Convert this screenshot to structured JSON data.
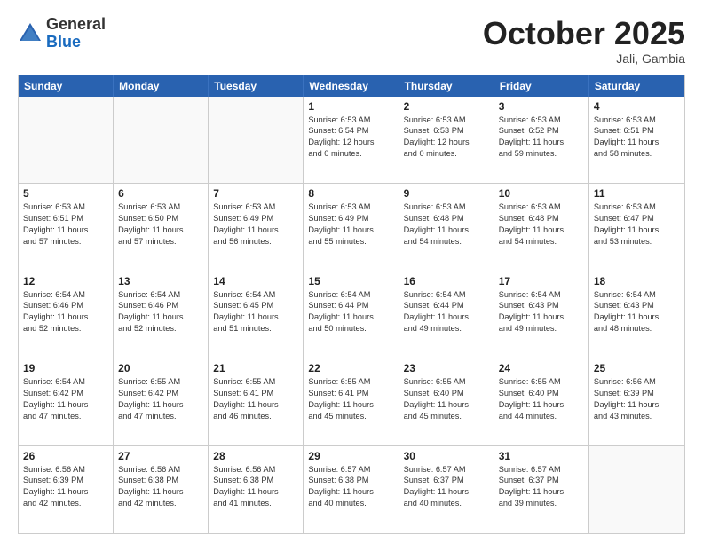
{
  "header": {
    "logo": {
      "general": "General",
      "blue": "Blue"
    },
    "title": "October 2025",
    "location": "Jali, Gambia"
  },
  "weekdays": [
    "Sunday",
    "Monday",
    "Tuesday",
    "Wednesday",
    "Thursday",
    "Friday",
    "Saturday"
  ],
  "rows": [
    [
      {
        "day": "",
        "text": ""
      },
      {
        "day": "",
        "text": ""
      },
      {
        "day": "",
        "text": ""
      },
      {
        "day": "1",
        "text": "Sunrise: 6:53 AM\nSunset: 6:54 PM\nDaylight: 12 hours\nand 0 minutes."
      },
      {
        "day": "2",
        "text": "Sunrise: 6:53 AM\nSunset: 6:53 PM\nDaylight: 12 hours\nand 0 minutes."
      },
      {
        "day": "3",
        "text": "Sunrise: 6:53 AM\nSunset: 6:52 PM\nDaylight: 11 hours\nand 59 minutes."
      },
      {
        "day": "4",
        "text": "Sunrise: 6:53 AM\nSunset: 6:51 PM\nDaylight: 11 hours\nand 58 minutes."
      }
    ],
    [
      {
        "day": "5",
        "text": "Sunrise: 6:53 AM\nSunset: 6:51 PM\nDaylight: 11 hours\nand 57 minutes."
      },
      {
        "day": "6",
        "text": "Sunrise: 6:53 AM\nSunset: 6:50 PM\nDaylight: 11 hours\nand 57 minutes."
      },
      {
        "day": "7",
        "text": "Sunrise: 6:53 AM\nSunset: 6:49 PM\nDaylight: 11 hours\nand 56 minutes."
      },
      {
        "day": "8",
        "text": "Sunrise: 6:53 AM\nSunset: 6:49 PM\nDaylight: 11 hours\nand 55 minutes."
      },
      {
        "day": "9",
        "text": "Sunrise: 6:53 AM\nSunset: 6:48 PM\nDaylight: 11 hours\nand 54 minutes."
      },
      {
        "day": "10",
        "text": "Sunrise: 6:53 AM\nSunset: 6:48 PM\nDaylight: 11 hours\nand 54 minutes."
      },
      {
        "day": "11",
        "text": "Sunrise: 6:53 AM\nSunset: 6:47 PM\nDaylight: 11 hours\nand 53 minutes."
      }
    ],
    [
      {
        "day": "12",
        "text": "Sunrise: 6:54 AM\nSunset: 6:46 PM\nDaylight: 11 hours\nand 52 minutes."
      },
      {
        "day": "13",
        "text": "Sunrise: 6:54 AM\nSunset: 6:46 PM\nDaylight: 11 hours\nand 52 minutes."
      },
      {
        "day": "14",
        "text": "Sunrise: 6:54 AM\nSunset: 6:45 PM\nDaylight: 11 hours\nand 51 minutes."
      },
      {
        "day": "15",
        "text": "Sunrise: 6:54 AM\nSunset: 6:44 PM\nDaylight: 11 hours\nand 50 minutes."
      },
      {
        "day": "16",
        "text": "Sunrise: 6:54 AM\nSunset: 6:44 PM\nDaylight: 11 hours\nand 49 minutes."
      },
      {
        "day": "17",
        "text": "Sunrise: 6:54 AM\nSunset: 6:43 PM\nDaylight: 11 hours\nand 49 minutes."
      },
      {
        "day": "18",
        "text": "Sunrise: 6:54 AM\nSunset: 6:43 PM\nDaylight: 11 hours\nand 48 minutes."
      }
    ],
    [
      {
        "day": "19",
        "text": "Sunrise: 6:54 AM\nSunset: 6:42 PM\nDaylight: 11 hours\nand 47 minutes."
      },
      {
        "day": "20",
        "text": "Sunrise: 6:55 AM\nSunset: 6:42 PM\nDaylight: 11 hours\nand 47 minutes."
      },
      {
        "day": "21",
        "text": "Sunrise: 6:55 AM\nSunset: 6:41 PM\nDaylight: 11 hours\nand 46 minutes."
      },
      {
        "day": "22",
        "text": "Sunrise: 6:55 AM\nSunset: 6:41 PM\nDaylight: 11 hours\nand 45 minutes."
      },
      {
        "day": "23",
        "text": "Sunrise: 6:55 AM\nSunset: 6:40 PM\nDaylight: 11 hours\nand 45 minutes."
      },
      {
        "day": "24",
        "text": "Sunrise: 6:55 AM\nSunset: 6:40 PM\nDaylight: 11 hours\nand 44 minutes."
      },
      {
        "day": "25",
        "text": "Sunrise: 6:56 AM\nSunset: 6:39 PM\nDaylight: 11 hours\nand 43 minutes."
      }
    ],
    [
      {
        "day": "26",
        "text": "Sunrise: 6:56 AM\nSunset: 6:39 PM\nDaylight: 11 hours\nand 42 minutes."
      },
      {
        "day": "27",
        "text": "Sunrise: 6:56 AM\nSunset: 6:38 PM\nDaylight: 11 hours\nand 42 minutes."
      },
      {
        "day": "28",
        "text": "Sunrise: 6:56 AM\nSunset: 6:38 PM\nDaylight: 11 hours\nand 41 minutes."
      },
      {
        "day": "29",
        "text": "Sunrise: 6:57 AM\nSunset: 6:38 PM\nDaylight: 11 hours\nand 40 minutes."
      },
      {
        "day": "30",
        "text": "Sunrise: 6:57 AM\nSunset: 6:37 PM\nDaylight: 11 hours\nand 40 minutes."
      },
      {
        "day": "31",
        "text": "Sunrise: 6:57 AM\nSunset: 6:37 PM\nDaylight: 11 hours\nand 39 minutes."
      },
      {
        "day": "",
        "text": ""
      }
    ]
  ]
}
